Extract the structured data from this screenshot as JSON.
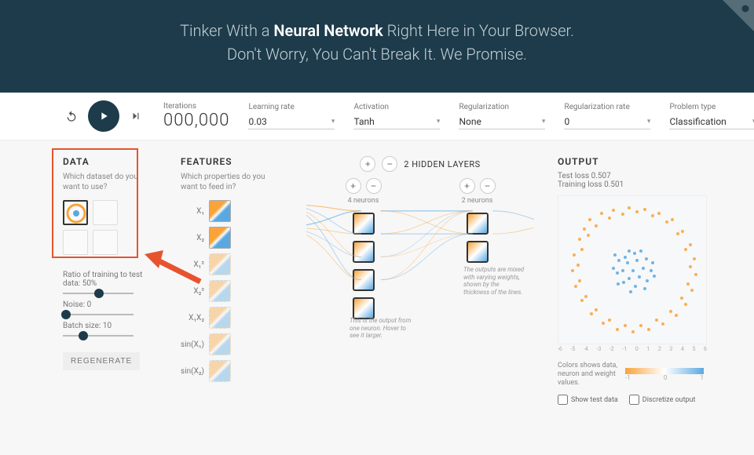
{
  "header": {
    "line1_pre": "Tinker With a ",
    "line1_bold": "Neural Network",
    "line1_post": " Right Here in Your Browser.",
    "line2": "Don't Worry, You Can't Break It. We Promise."
  },
  "controls": {
    "iterations_label": "Iterations",
    "iterations_value": "000,000",
    "learning_rate": {
      "label": "Learning rate",
      "value": "0.03"
    },
    "activation": {
      "label": "Activation",
      "value": "Tanh"
    },
    "regularization": {
      "label": "Regularization",
      "value": "None"
    },
    "regularization_rate": {
      "label": "Regularization rate",
      "value": "0"
    },
    "problem_type": {
      "label": "Problem type",
      "value": "Classification"
    }
  },
  "data": {
    "title": "DATA",
    "subtitle": "Which dataset do you want to use?",
    "ratio_label": "Ratio of training to test data:  50%",
    "noise_label": "Noise:  0",
    "batch_label": "Batch size:  10",
    "regenerate": "REGENERATE"
  },
  "features": {
    "title": "FEATURES",
    "subtitle": "Which properties do you want to feed in?",
    "labels": [
      "X₁",
      "X₂",
      "X₁²",
      "X₂²",
      "X₁X₂",
      "sin(X₁)",
      "sin(X₂)"
    ]
  },
  "network": {
    "title": "2  HIDDEN LAYERS",
    "layer1_label": "4 neurons",
    "layer2_label": "2 neurons",
    "annotation1": "This is the output from one neuron. Hover to see it larger.",
    "annotation2": "The outputs are mixed with varying weights, shown by the thickness of the lines."
  },
  "output": {
    "title": "OUTPUT",
    "test_loss": "Test loss 0.507",
    "train_loss": "Training loss 0.501",
    "legend_text": "Colors shows data, neuron and weight values.",
    "grad_min": "-1",
    "grad_mid": "0",
    "grad_max": "1",
    "show_test": "Show test data",
    "discretize": "Discretize output",
    "axis_ticks": [
      "-6",
      "-5",
      "-4",
      "-3",
      "-2",
      "-1",
      "0",
      "1",
      "2",
      "3",
      "4",
      "5",
      "6"
    ]
  }
}
